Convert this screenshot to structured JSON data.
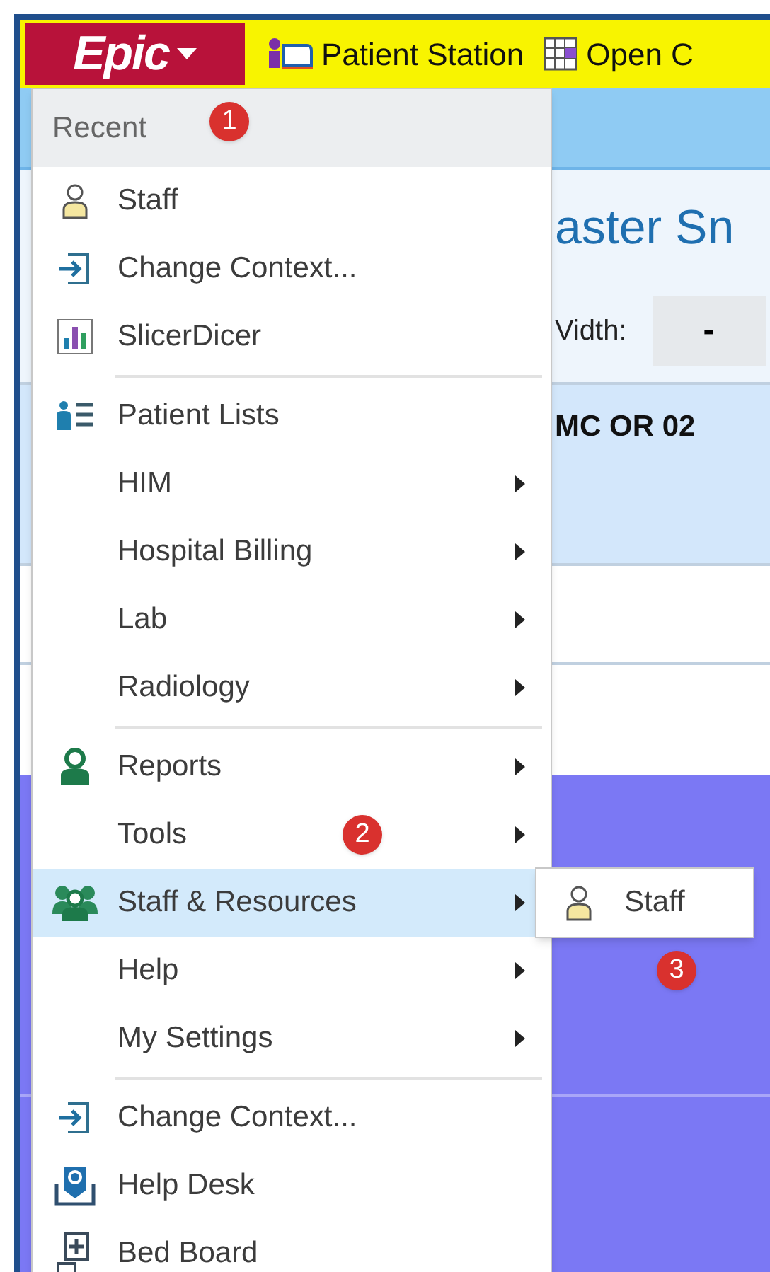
{
  "toolbar": {
    "epic_button": "Epic",
    "items": [
      "Patient Station",
      "Open C"
    ]
  },
  "background": {
    "title": "aster Sn",
    "width_label": "Vidth:",
    "width_value": "-",
    "row_label": "MC OR 02"
  },
  "menu": {
    "header": "Recent",
    "groups": [
      {
        "items": [
          {
            "label": "Staff",
            "submenu": false,
            "selected": false
          },
          {
            "label": "Change Context...",
            "submenu": false,
            "selected": false
          },
          {
            "label": "SlicerDicer",
            "submenu": false,
            "selected": false
          }
        ]
      },
      {
        "items": [
          {
            "label": "Patient Lists",
            "submenu": false,
            "selected": false
          },
          {
            "label": "HIM",
            "submenu": true,
            "selected": false
          },
          {
            "label": "Hospital Billing",
            "submenu": true,
            "selected": false
          },
          {
            "label": "Lab",
            "submenu": true,
            "selected": false
          },
          {
            "label": "Radiology",
            "submenu": true,
            "selected": false
          }
        ]
      },
      {
        "items": [
          {
            "label": "Reports",
            "submenu": true,
            "selected": false
          },
          {
            "label": "Tools",
            "submenu": true,
            "selected": false
          },
          {
            "label": "Staff & Resources",
            "submenu": true,
            "selected": true
          },
          {
            "label": "Help",
            "submenu": true,
            "selected": false
          },
          {
            "label": "My Settings",
            "submenu": true,
            "selected": false
          }
        ]
      },
      {
        "items": [
          {
            "label": "Change Context...",
            "submenu": false,
            "selected": false
          },
          {
            "label": "Help Desk",
            "submenu": false,
            "selected": false
          },
          {
            "label": "Bed Board",
            "submenu": false,
            "selected": false
          }
        ]
      }
    ]
  },
  "submenu": {
    "items": [
      {
        "label": "Staff"
      }
    ]
  },
  "callouts": [
    "1",
    "2",
    "3"
  ]
}
